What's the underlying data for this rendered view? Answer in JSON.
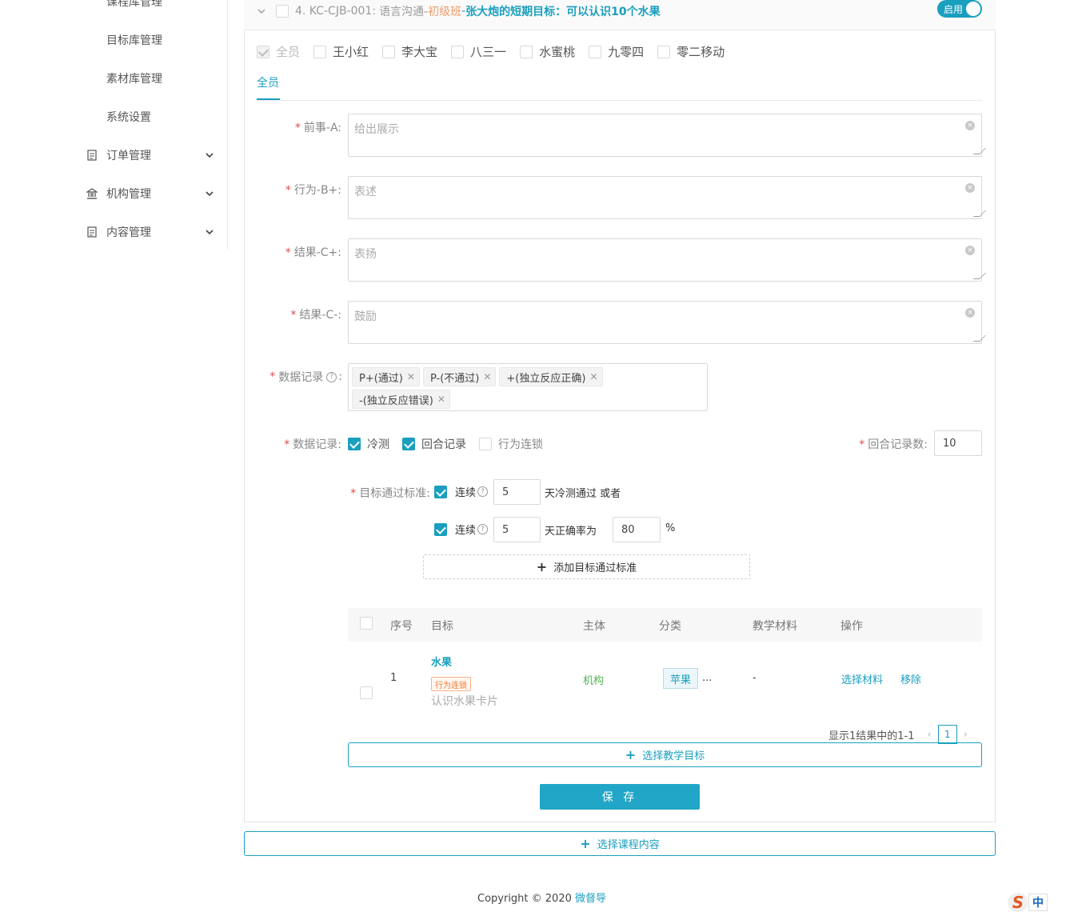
{
  "sidebar": {
    "items_sub": [
      "课程库管理",
      "目标库管理",
      "素材库管理",
      "系统设置"
    ],
    "groups": [
      {
        "label": "订单管理",
        "icon": "document-icon"
      },
      {
        "label": "机构管理",
        "icon": "institution-icon"
      },
      {
        "label": "内容管理",
        "icon": "document-icon"
      }
    ]
  },
  "card": {
    "title_num": "4. KC-CJB-001:",
    "title_course": "语言沟通-",
    "title_level": "初级班",
    "title_sep": "-",
    "title_goal": "张大炮的短期目标：可以认识10个水果",
    "toggle_label": "启用"
  },
  "members": [
    {
      "name": "全员",
      "state": "disabled"
    },
    {
      "name": "王小红",
      "state": "off"
    },
    {
      "name": "李大宝",
      "state": "off"
    },
    {
      "name": "八三一",
      "state": "off"
    },
    {
      "name": "水蜜桃",
      "state": "off"
    },
    {
      "name": "九零四",
      "state": "off"
    },
    {
      "name": "零二移动",
      "state": "off"
    }
  ],
  "tab": "全员",
  "fields": {
    "a_label": "前事-A:",
    "a_placeholder": "给出展示",
    "b_label": "行为-B+:",
    "b_placeholder": "表述",
    "cp_label": "结果-C+:",
    "cp_placeholder": "表扬",
    "cm_label": "结果-C-:",
    "cm_placeholder": "鼓励",
    "record_label": "数据记录",
    "record_colon": ":",
    "tags": [
      "P+(通过)",
      "P-(不通过)",
      "+(独立反应正确)",
      "-(独立反应错误)"
    ],
    "record2_label": "数据记录:",
    "options": [
      {
        "label": "冷测",
        "checked": true
      },
      {
        "label": "回合记录",
        "checked": true
      },
      {
        "label": "行为连锁",
        "checked": false
      }
    ],
    "rounds_label": "回合记录数:",
    "rounds_value": "10",
    "pass_label": "目标通过标准:",
    "rule1_prefix": "连续",
    "rule1_days": "5",
    "rule1_suffix": "天冷测通过 或者",
    "rule2_prefix": "连续",
    "rule2_days": "5",
    "rule2_mid": "天正确率为",
    "rule2_pct": "80",
    "rule2_unit": "%",
    "add_rule": "添加目标通过标准"
  },
  "table": {
    "headers": [
      "序号",
      "目标",
      "主体",
      "分类",
      "教学材料",
      "操作"
    ],
    "row": {
      "index": "1",
      "goal": "水果",
      "badge": "行为连锁",
      "desc": "认识水果卡片",
      "subject": "机构",
      "category": "苹果",
      "more": "...",
      "material": "-",
      "action_select": "选择材料",
      "action_remove": "移除"
    },
    "pager_text": "显示1结果中的1-1",
    "page": "1"
  },
  "buttons": {
    "select_goal": "选择教学目标",
    "save": "保 存",
    "select_content": "选择课程内容"
  },
  "footer": {
    "copyright": "Copyright © 2020 ",
    "brand": "微督导"
  },
  "ime": {
    "logo": "S",
    "mode": "中"
  },
  "colors": {
    "accent": "#1a9fbf",
    "required": "#e14b4b",
    "level": "#ef7c3a",
    "subject": "#52b052"
  }
}
